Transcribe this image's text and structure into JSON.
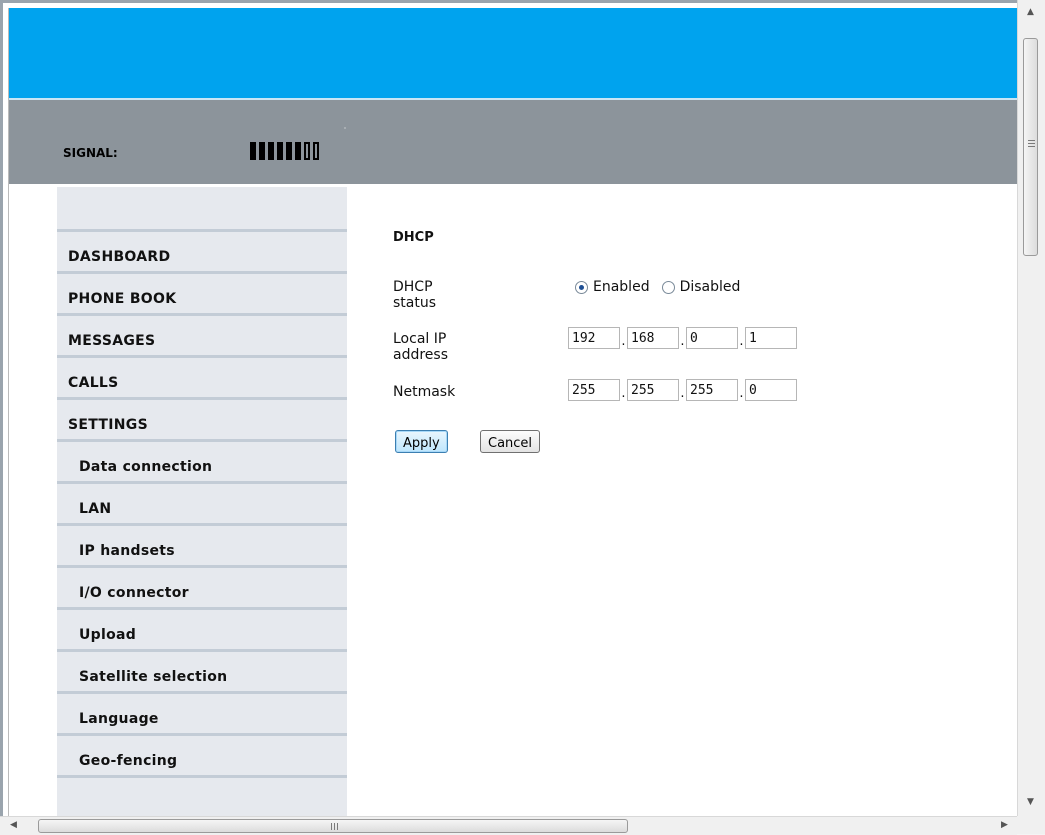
{
  "header": {
    "signal_label": "SIGNAL:",
    "signal_strength": {
      "filled_bars": 6,
      "total_bars": 8
    }
  },
  "sidebar": {
    "items": [
      {
        "label": "DASHBOARD",
        "level": "top"
      },
      {
        "label": "PHONE BOOK",
        "level": "top"
      },
      {
        "label": "MESSAGES",
        "level": "top"
      },
      {
        "label": "CALLS",
        "level": "top"
      },
      {
        "label": "SETTINGS",
        "level": "top"
      },
      {
        "label": "Data connection",
        "level": "sub"
      },
      {
        "label": "LAN",
        "level": "sub"
      },
      {
        "label": "IP handsets",
        "level": "sub"
      },
      {
        "label": "I/O connector",
        "level": "sub"
      },
      {
        "label": "Upload",
        "level": "sub"
      },
      {
        "label": "Satellite selection",
        "level": "sub"
      },
      {
        "label": "Language",
        "level": "sub"
      },
      {
        "label": "Geo-fencing",
        "level": "sub"
      }
    ]
  },
  "dhcp": {
    "title": "DHCP",
    "status_label": "DHCP status",
    "status_options": [
      "Enabled",
      "Disabled"
    ],
    "status_selected": "Enabled",
    "local_ip_label": "Local IP address",
    "local_ip": [
      "192",
      "168",
      "0",
      "1"
    ],
    "netmask_label": "Netmask",
    "netmask": [
      "255",
      "255",
      "255",
      "0"
    ],
    "separator": ".",
    "apply_label": "Apply",
    "cancel_label": "Cancel"
  },
  "colors": {
    "banner": "#00a3ee",
    "status_bar": "#8c949b",
    "sidebar_bg": "#e6e9ee"
  }
}
